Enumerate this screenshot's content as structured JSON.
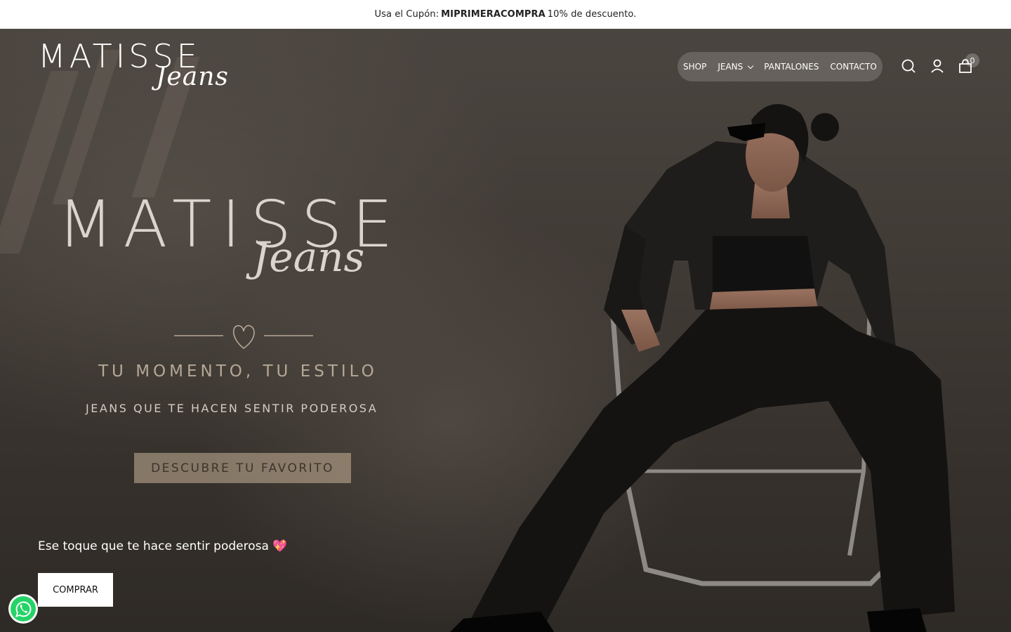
{
  "announcement": {
    "prefix": "Usa el Cupón:",
    "code": "MIPRIMERACOMPRA",
    "suffix": "10% de descuento."
  },
  "logo": {
    "main": "MATISSE",
    "script": "Jeans"
  },
  "nav": {
    "items": [
      {
        "label": "SHOP"
      },
      {
        "label": "JEANS"
      },
      {
        "label": "PANTALONES"
      },
      {
        "label": "CONTACTO"
      }
    ]
  },
  "header_icons": {
    "search": "search-icon",
    "account": "user-icon",
    "cart": "cart-icon",
    "cart_count": "0"
  },
  "hero_graphic": {
    "title": "MATISSE",
    "script": "Jeans",
    "tagline": "TU MOMENTO, TU ESTILO",
    "subtagline": "JEANS QUE TE HACEN SENTIR PODEROSA",
    "discover_label": "DESCUBRE TU FAVORITO"
  },
  "hero": {
    "text": "Ese toque que te hace sentir poderosa 💖",
    "cta_label": "COMPRAR"
  },
  "whatsapp": {
    "icon": "whatsapp-icon"
  },
  "colors": {
    "announce_bg": "#ffffff",
    "hero_bg": "#3f3934",
    "accent_tan": "#c8b298",
    "text_light": "#d9d4cd"
  }
}
